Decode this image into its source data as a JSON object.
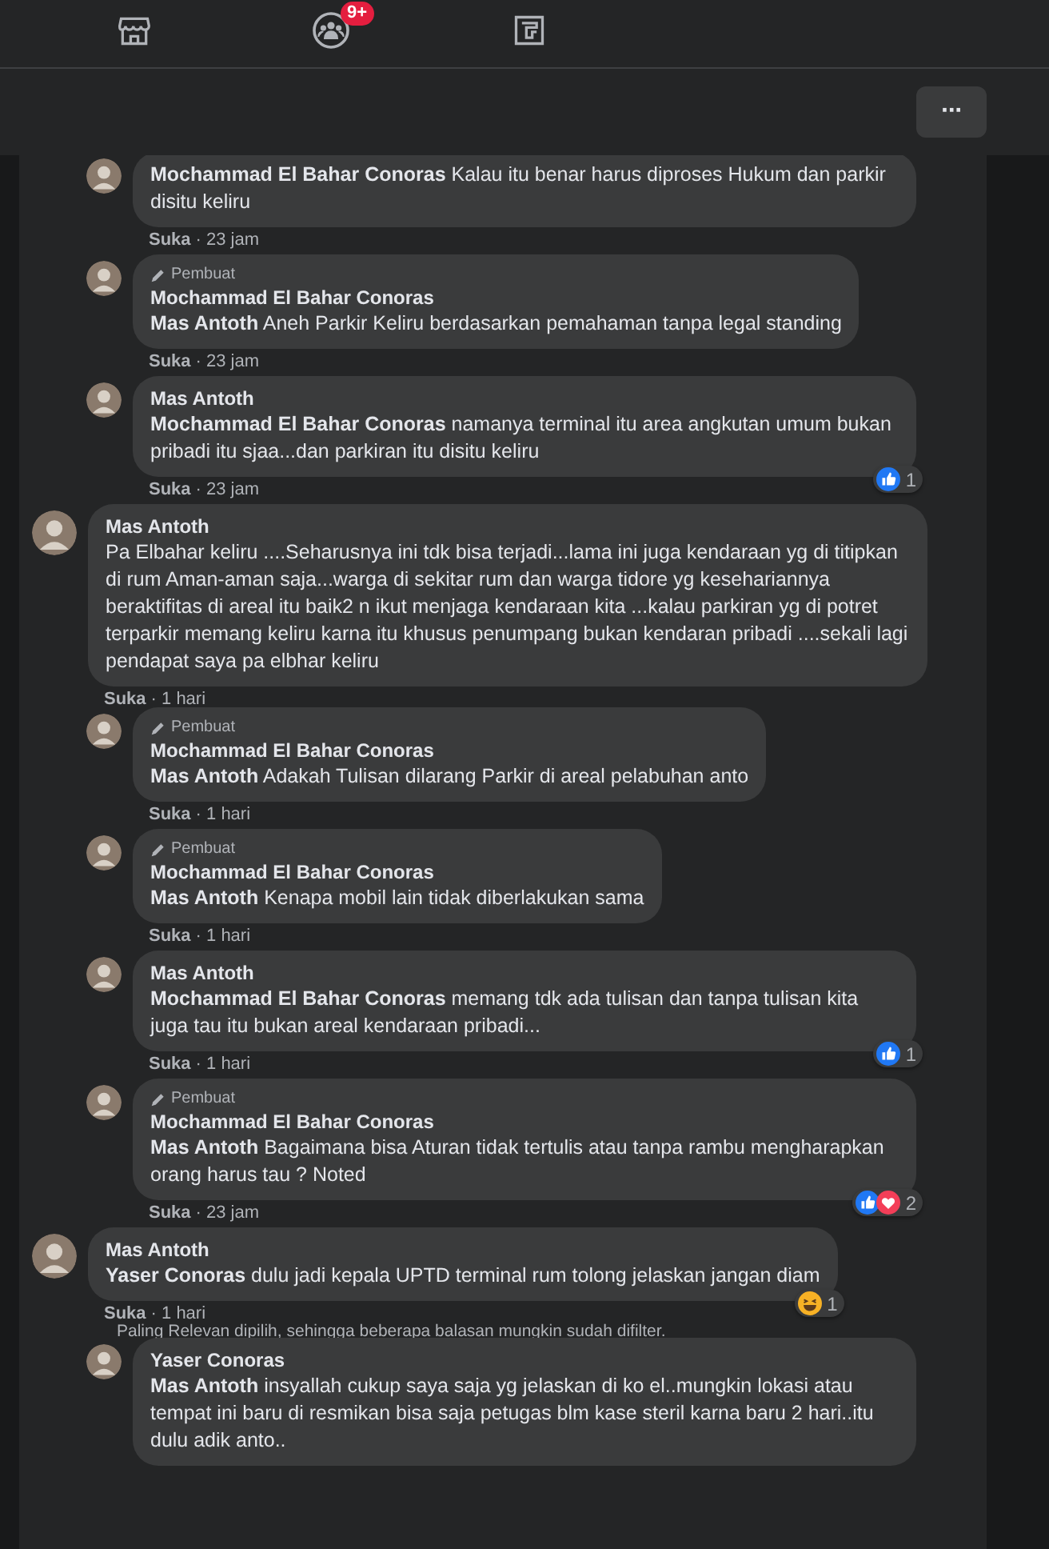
{
  "nav": {
    "groups_badge": "9+"
  },
  "header": {
    "more_label": "···"
  },
  "threads": [
    {
      "replies": [
        {
          "mention": "Mochammad El Bahar Conoras",
          "text": "Kalau itu benar harus diproses Hukum dan parkir disitu keliru",
          "like": "Suka",
          "time": "· 23 jam"
        },
        {
          "author_badge": "Pembuat",
          "author": "Mochammad El Bahar Conoras",
          "mention": "Mas Antoth",
          "text": "Aneh Parkir Keliru berdasarkan pemahaman tanpa legal standing",
          "like": "Suka",
          "time": "· 23 jam"
        },
        {
          "author": "Mas Antoth",
          "mention": "Mochammad El Bahar Conoras",
          "text": "namanya terminal itu area angkutan umum bukan pribadi itu sjaa...dan parkiran itu disitu keliru",
          "like": "Suka",
          "time": "· 23 jam",
          "reactions": {
            "icons": [
              {
                "kind": "like"
              }
            ],
            "count": "1"
          }
        }
      ]
    },
    {
      "comment": {
        "author": "Mas Antoth",
        "text": "Pa Elbahar keliru ....Seharusnya ini tdk bisa terjadi...lama ini juga kendaraan yg di titipkan di rum Aman-aman saja...warga di sekitar rum dan warga tidore yg kesehariannya beraktifitas di areal itu baik2 n ikut menjaga kendaraan kita ...kalau parkiran yg di potret terparkir memang keliru karna itu khusus penumpang bukan kendaran pribadi ....sekali lagi pendapat saya pa elbhar keliru",
        "like": "Suka",
        "time": "· 1 hari"
      },
      "replies": [
        {
          "author_badge": "Pembuat",
          "author": "Mochammad El Bahar Conoras",
          "mention": "Mas Antoth",
          "text": "Adakah Tulisan dilarang Parkir di areal pelabuhan anto",
          "like": "Suka",
          "time": "· 1 hari"
        },
        {
          "author_badge": "Pembuat",
          "author": "Mochammad El Bahar Conoras",
          "mention": "Mas Antoth",
          "text": "Kenapa mobil lain tidak diberlakukan sama",
          "like": "Suka",
          "time": "· 1 hari"
        },
        {
          "author": "Mas Antoth",
          "mention": "Mochammad El Bahar Conoras",
          "text": "memang tdk ada tulisan dan tanpa tulisan kita juga tau itu bukan areal kendaraan pribadi...",
          "like": "Suka",
          "time": "· 1 hari",
          "reactions": {
            "icons": [
              {
                "kind": "like"
              }
            ],
            "count": "1"
          }
        },
        {
          "author_badge": "Pembuat",
          "author": "Mochammad El Bahar Conoras",
          "mention": "Mas Antoth",
          "text": "Bagaimana bisa Aturan tidak tertulis atau tanpa rambu mengharapkan orang harus tau ? Noted",
          "like": "Suka",
          "time": "· 23 jam",
          "reactions": {
            "icons": [
              {
                "kind": "like"
              },
              {
                "kind": "love"
              }
            ],
            "count": "2"
          }
        }
      ]
    },
    {
      "comment": {
        "author": "Mas Antoth",
        "mention": "Yaser Conoras",
        "text": "dulu jadi kepala UPTD terminal rum tolong jelaskan jangan diam",
        "like": "Suka",
        "time": "· 1 hari",
        "reactions": {
          "icons": [
            {
              "kind": "haha"
            }
          ],
          "count": "1"
        }
      },
      "filter_note": "Paling Relevan dipilih, sehingga beberapa balasan mungkin sudah difilter.",
      "replies": [
        {
          "author": "Yaser Conoras",
          "mention": "Mas Antoth",
          "text": "insyallah cukup saya saja yg jelaskan di ko el..mungkin lokasi atau tempat ini baru di resmikan bisa saja petugas blm kase steril karna baru 2 hari..itu dulu adik anto.."
        }
      ]
    }
  ]
}
